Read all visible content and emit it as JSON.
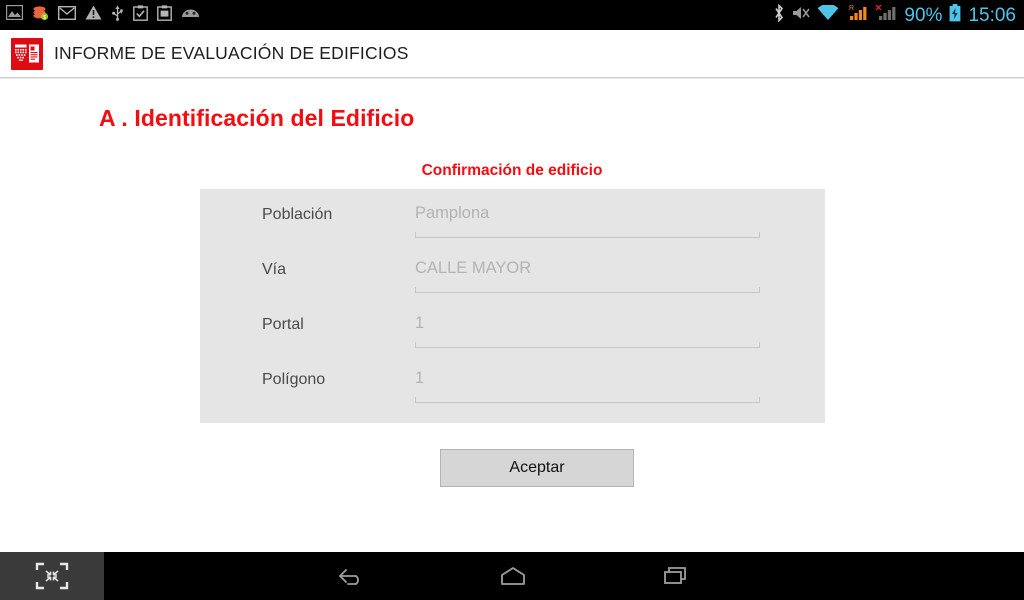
{
  "status_bar": {
    "left_icons": [
      {
        "name": "screenshot-icon",
        "label": "screenshot"
      },
      {
        "name": "coins-icon",
        "label": "coins"
      },
      {
        "name": "mail-icon",
        "label": "mail"
      },
      {
        "name": "warning-icon",
        "label": "warning"
      },
      {
        "name": "usb-icon",
        "label": "usb"
      },
      {
        "name": "clipboard-check-icon",
        "label": "clipboard-check"
      },
      {
        "name": "clipboard-download-icon",
        "label": "clipboard-download"
      },
      {
        "name": "android-face-icon",
        "label": "android-face"
      }
    ],
    "right_icons": [
      {
        "name": "bluetooth-icon",
        "label": "bluetooth"
      },
      {
        "name": "mute-icon",
        "label": "sound-muted"
      },
      {
        "name": "wifi-icon",
        "label": "wifi"
      },
      {
        "name": "signal-roaming-icon",
        "label": "signal-roaming",
        "badge": "R"
      },
      {
        "name": "signal-nosim-icon",
        "label": "signal-no-service",
        "badge": "X"
      }
    ],
    "battery_percent": "90%",
    "clock": "15:06",
    "accent_color": "#4fc3e8",
    "background_color": "#000000"
  },
  "app_bar": {
    "title": "INFORME DE EVALUACIÓN DE EDIFICIOS",
    "logo_name": "navarra-building-report-logo",
    "logo_color": "#dd0b14"
  },
  "content": {
    "section_title": "A . Identificación del Edificio",
    "form_subtitle": "Confirmación de edificio",
    "title_color": "#f40c10",
    "panel_color": "#e5e5e5",
    "fields": [
      {
        "label": "Población",
        "value": "Pamplona",
        "placeholder": "Población"
      },
      {
        "label": "Vía",
        "value": "CALLE MAYOR",
        "placeholder": "Vía"
      },
      {
        "label": "Portal",
        "value": "1",
        "placeholder": "Portal"
      },
      {
        "label": "Polígono",
        "value": "1",
        "placeholder": "Polígono"
      }
    ],
    "accept_button": "Aceptar"
  },
  "nav_bar": {
    "shrink_label": "exit-fullscreen",
    "back_label": "back",
    "home_label": "home",
    "recents_label": "recents",
    "background_color": "#000000"
  }
}
